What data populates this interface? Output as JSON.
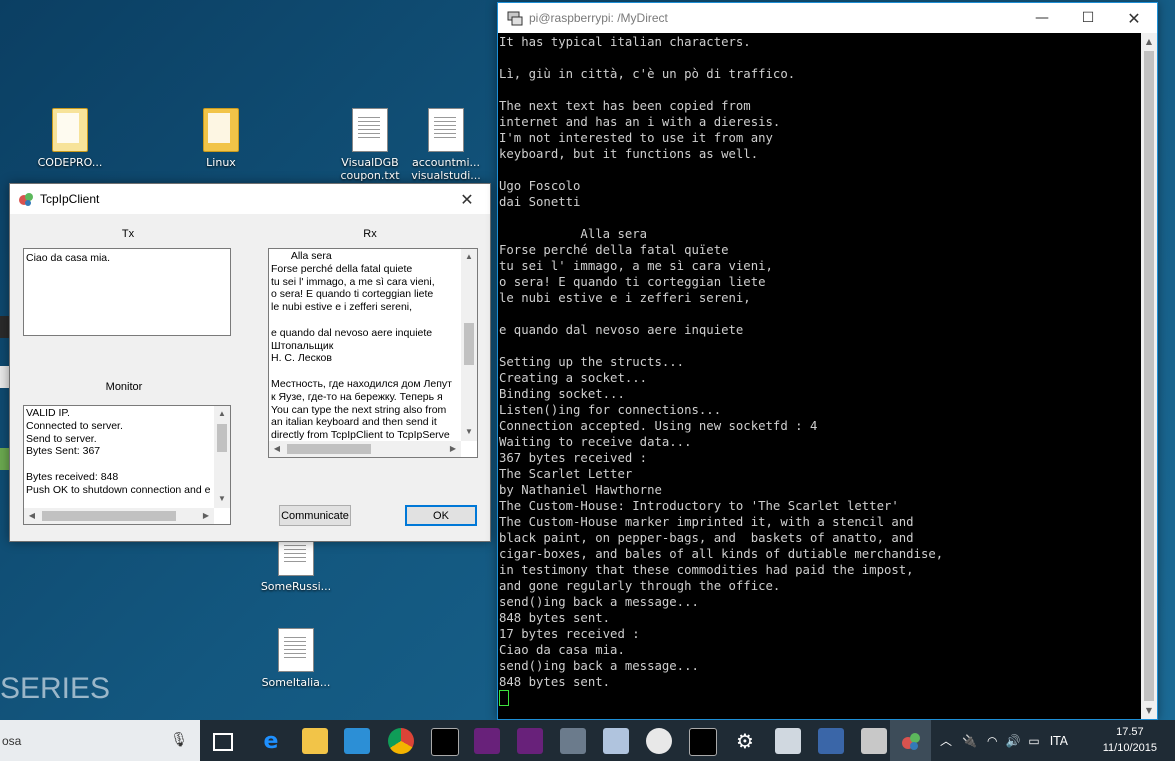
{
  "desktop": {
    "icons": [
      {
        "label": "CODEPRO..."
      },
      {
        "label": "Linux"
      },
      {
        "label": "VisualDGB coupon.txt"
      },
      {
        "label": "accountmi... visualstudi..."
      },
      {
        "label": "SomeRussi..."
      },
      {
        "label": "SomeItalia..."
      }
    ],
    "bg_text": "SERIES"
  },
  "client": {
    "title": "TcpIpClient",
    "tx_label": "Tx",
    "rx_label": "Rx",
    "monitor_label": "Monitor",
    "tx_text": "Ciao da casa mia.",
    "rx_lines": [
      "       Alla sera",
      "Forse perché della fatal quiete",
      "tu sei l' immago, a me sì cara vieni,",
      "o sera! E quando ti corteggian liete",
      "le nubi estive e i zefferi sereni,",
      "",
      "e quando dal nevoso aere inquiete",
      "Штопальщик",
      "Н. С. Лесков",
      "",
      "Местность, где находился дом Лепут",
      "к Яузе, где-то на бережку. Теперь я",
      "You can type the next string also from",
      "an italian keyboard and then send it",
      "directly from TcpIpClient to TcpIpServe"
    ],
    "monitor_lines": [
      "VALID IP.",
      "Connected to server.",
      "Send to server.",
      "Bytes Sent: 367",
      "",
      "Bytes received: 848",
      "Push OK to shutdown connection and e"
    ],
    "communicate_label": "Communicate",
    "ok_label": "OK"
  },
  "terminal": {
    "title": "pi@raspberrypi: /MyDirect",
    "lines": [
      "It has typical italian characters.",
      "",
      "Lì, giù in città, c'è un pò di traffico.",
      "",
      "The next text has been copied from",
      "internet and has an i with a dieresis.",
      "I'm not interested to use it from any",
      "keyboard, but it functions as well.",
      "",
      "Ugo Foscolo",
      "dai Sonetti",
      "",
      "           Alla sera",
      "Forse perché della fatal quïete",
      "tu sei l' immago, a me sì cara vieni,",
      "o sera! E quando ti corteggian liete",
      "le nubi estive e i zefferi sereni,",
      "",
      "e quando dal nevoso aere inquiete",
      "",
      "Setting up the structs...",
      "Creating a socket...",
      "Binding socket...",
      "Listen()ing for connections...",
      "Connection accepted. Using new socketfd : 4",
      "Waiting to receive data...",
      "367 bytes received :",
      "The Scarlet Letter",
      "by Nathaniel Hawthorne",
      "The Custom-House: Introductory to 'The Scarlet letter'",
      "The Custom-House marker imprinted it, with a stencil and",
      "black paint, on pepper-bags, and  baskets of anatto, and",
      "cigar-boxes, and bales of all kinds of dutiable merchandise,",
      "in testimony that these commodities had paid the impost,",
      "and gone regularly through the office.",
      "send()ing back a message...",
      "848 bytes sent.",
      "17 bytes received :",
      "Ciao da casa mia.",
      "send()ing back a message...",
      "848 bytes sent."
    ]
  },
  "taskbar": {
    "search_text": "osa",
    "lang": "ITA",
    "time": "17.57",
    "date": "11/10/2015"
  }
}
